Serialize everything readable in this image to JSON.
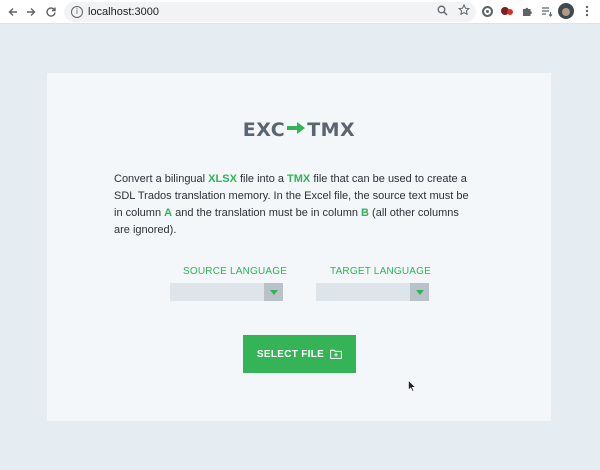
{
  "browser": {
    "url": "localhost:3000",
    "info_icon": "i"
  },
  "app": {
    "logo_left": "EXC",
    "logo_right": "TMX",
    "description": {
      "p1": "Convert a bilingual ",
      "xlsx": "XLSX",
      "p2": " file into a ",
      "tmx": "TMX",
      "p3": " file that can be used to create a SDL Trados translation memory. In the Excel file, the source text must be in column ",
      "col_a": "A",
      "p4": " and the translation must be in column ",
      "col_b": "B",
      "p5": " (all other columns are ignored)."
    },
    "source_language_label": "SOURCE LANGUAGE",
    "target_language_label": "TARGET LANGUAGE",
    "source_language_value": "",
    "target_language_value": "",
    "select_file_label": "SELECT FILE"
  },
  "colors": {
    "accent": "#35b357",
    "logo": "#5b6570",
    "page_bg": "#e6edf2",
    "card_bg": "#f3f7fa"
  }
}
